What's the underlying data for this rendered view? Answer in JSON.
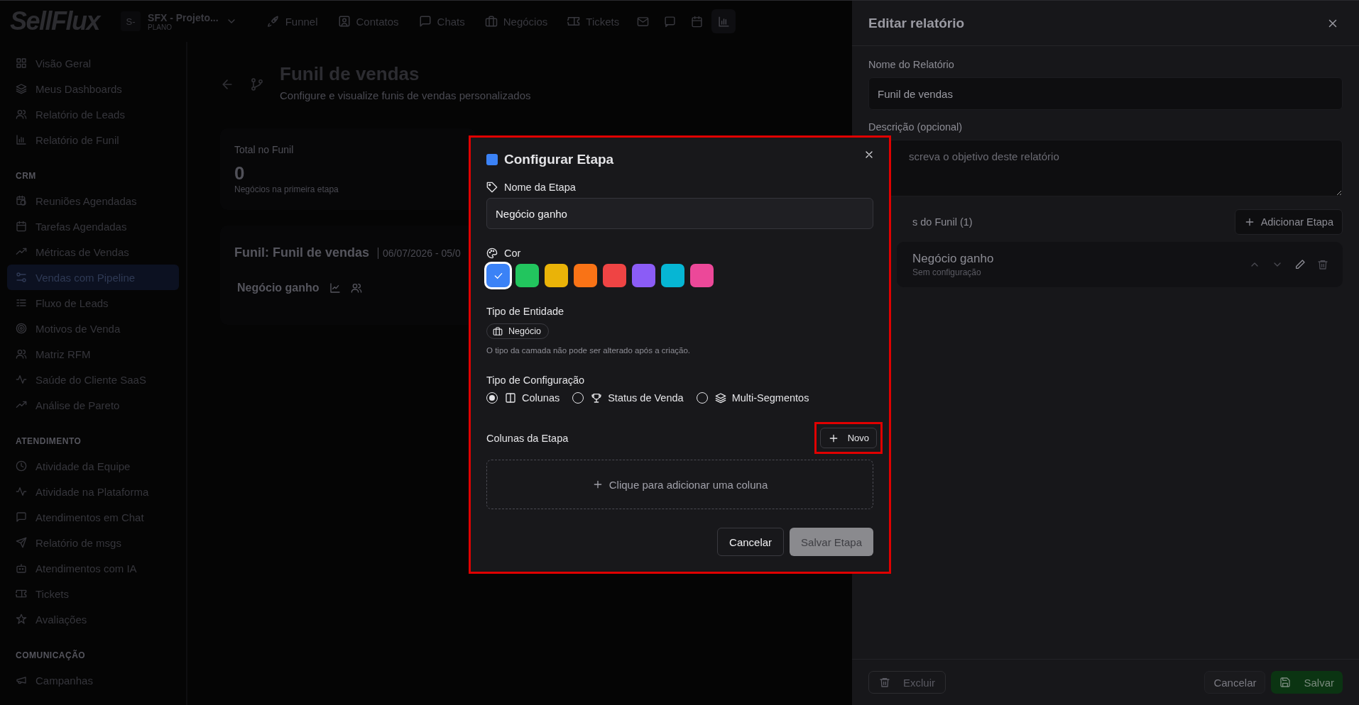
{
  "logo": "SellFlux",
  "workspace": {
    "initials": "S-",
    "name": "SFX - Projeto...",
    "plan": "PLANO"
  },
  "nav": [
    {
      "label": "Funnel",
      "selected": false
    },
    {
      "label": "Contatos",
      "selected": false
    },
    {
      "label": "Chats",
      "selected": false
    },
    {
      "label": "Negócios",
      "selected": false
    },
    {
      "label": "Tickets",
      "selected": false
    }
  ],
  "nav_icons": [
    {
      "selected": false
    },
    {
      "selected": false
    },
    {
      "selected": false
    },
    {
      "selected": true
    }
  ],
  "sidebar": {
    "sections": [
      {
        "items": [
          {
            "label": "Visão Geral",
            "selected": false
          },
          {
            "label": "Meus Dashboards",
            "selected": false
          },
          {
            "label": "Relatório de Leads",
            "selected": false
          },
          {
            "label": "Relatório de Funil",
            "selected": false
          }
        ]
      },
      {
        "heading": "CRM",
        "items": [
          {
            "label": "Reuniões Agendadas",
            "selected": false
          },
          {
            "label": "Tarefas Agendadas",
            "selected": false
          },
          {
            "label": "Métricas de Vendas",
            "selected": false
          },
          {
            "label": "Vendas com Pipeline",
            "selected": true
          },
          {
            "label": "Fluxo de Leads",
            "selected": false
          },
          {
            "label": "Motivos de Venda",
            "selected": false
          },
          {
            "label": "Matriz RFM",
            "selected": false
          },
          {
            "label": "Saúde do Cliente SaaS",
            "selected": false
          },
          {
            "label": "Análise de Pareto",
            "selected": false
          }
        ]
      },
      {
        "heading": "ATENDIMENTO",
        "items": [
          {
            "label": "Atividade da Equipe",
            "selected": false
          },
          {
            "label": "Atividade na Plataforma",
            "selected": false
          },
          {
            "label": "Atendimentos em Chat",
            "selected": false
          },
          {
            "label": "Relatório de msgs",
            "selected": false
          },
          {
            "label": "Atendimentos com IA",
            "selected": false
          },
          {
            "label": "Tickets",
            "selected": false
          },
          {
            "label": "Avaliações",
            "selected": false
          }
        ]
      },
      {
        "heading": "COMUNICAÇÃO",
        "items": [
          {
            "label": "Campanhas",
            "selected": false
          }
        ]
      }
    ]
  },
  "page": {
    "title": "Funil de vendas",
    "subtitle": "Configure e visualize funis de vendas personalizados",
    "summary": {
      "label": "Total no Funil",
      "value": "0",
      "caption": "Negócios na primeira etapa"
    },
    "funnel": {
      "title": "Funil: Funil de vendas",
      "date": "06/07/2026 - 05/0",
      "stage": "Negócio ganho"
    }
  },
  "report_panel": {
    "title": "Editar relatório",
    "name_label": "Nome do Relatório",
    "name_value": "Funil de vendas",
    "description_label": "Descrição (opcional)",
    "description_placeholder": "screva o objetivo deste relatório",
    "stages_label": "s do Funil (1)",
    "add_stage": "Adicionar Etapa",
    "stages": [
      {
        "name": "Negócio ganho",
        "status": "Sem configuração"
      }
    ],
    "delete": "Excluir",
    "cancel": "Cancelar",
    "save": "Salvar"
  },
  "modal": {
    "highlighted": true,
    "title": "Configurar Etapa",
    "name_label": "Nome da Etapa",
    "name_value": "Negócio ganho",
    "color_label": "Cor",
    "colors": [
      {
        "color": "#3b82f6",
        "selected": true
      },
      {
        "color": "#22c55e",
        "selected": false
      },
      {
        "color": "#eab308",
        "selected": false
      },
      {
        "color": "#f97316",
        "selected": false
      },
      {
        "color": "#ef4444",
        "selected": false
      },
      {
        "color": "#8b5cf6",
        "selected": false
      },
      {
        "color": "#06b6d4",
        "selected": false
      },
      {
        "color": "#ec4899",
        "selected": false
      }
    ],
    "entity_label": "Tipo de Entidade",
    "entity": "Negócio",
    "entity_note": "O tipo da camada não pode ser alterado após a criação.",
    "config_label": "Tipo de Configuração",
    "config_options": [
      {
        "label": "Colunas",
        "selected": true
      },
      {
        "label": "Status de Venda",
        "selected": false
      },
      {
        "label": "Multi-Segmentos",
        "selected": false
      }
    ],
    "columns_label": "Colunas da Etapa",
    "new_button": {
      "label": "Novo",
      "highlighted": true
    },
    "empty_hint": "Clique para adicionar uma coluna",
    "cancel": "Cancelar",
    "save": {
      "label": "Salvar Etapa",
      "disabled": true
    }
  }
}
